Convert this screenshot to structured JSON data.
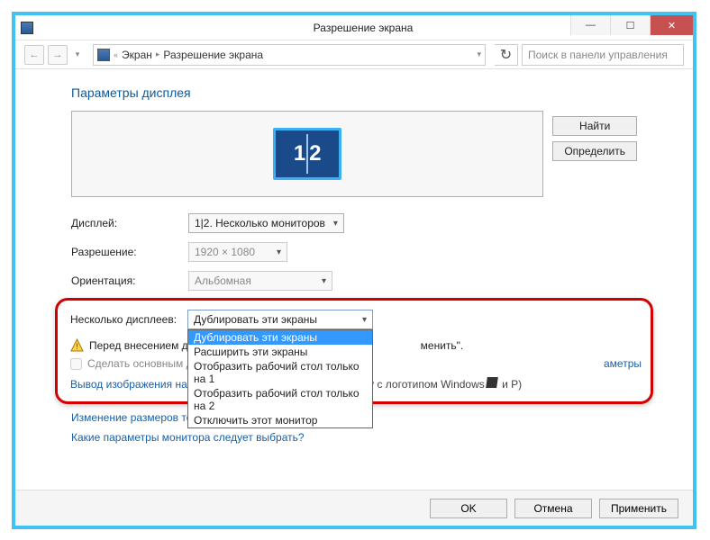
{
  "window": {
    "title": "Разрешение экрана"
  },
  "breadcrumb": {
    "item1": "Экран",
    "item2": "Разрешение экрана"
  },
  "search": {
    "placeholder": "Поиск в панели управления"
  },
  "heading": "Параметры дисплея",
  "buttons": {
    "find": "Найти",
    "identify": "Определить",
    "ok": "OK",
    "cancel": "Отмена",
    "apply": "Применить"
  },
  "monitor": {
    "left": "1",
    "right": "2"
  },
  "form": {
    "display_label": "Дисплей:",
    "display_value": "1|2. Несколько мониторов",
    "resolution_label": "Разрешение:",
    "resolution_value": "1920 × 1080",
    "orientation_label": "Ориентация:",
    "orientation_value": "Альбомная",
    "multi_label": "Несколько дисплеев:",
    "multi_value": "Дублировать эти экраны"
  },
  "dropdown": {
    "opt0": "Дублировать эти экраны",
    "opt1": "Расширить эти экраны",
    "opt2": "Отобразить рабочий стол только на 1",
    "opt3": "Отобразить рабочий стол только на 2",
    "opt4": "Отключить этот монитор"
  },
  "warning": {
    "prefix": "Перед внесением д",
    "suffix": "менить\"."
  },
  "checkbox": {
    "label": "Сделать основным д"
  },
  "advanced": {
    "label_full": "Дополнительные параметры",
    "label_visible": "аметры"
  },
  "projection_link": {
    "a": "Вывод изображения на второй экран",
    "b": " (или нажмите клавишу с логотипом Windows",
    "c": " и P)"
  },
  "link2": "Изменение размеров текста и других элементов",
  "link3": "Какие параметры монитора следует выбрать?"
}
